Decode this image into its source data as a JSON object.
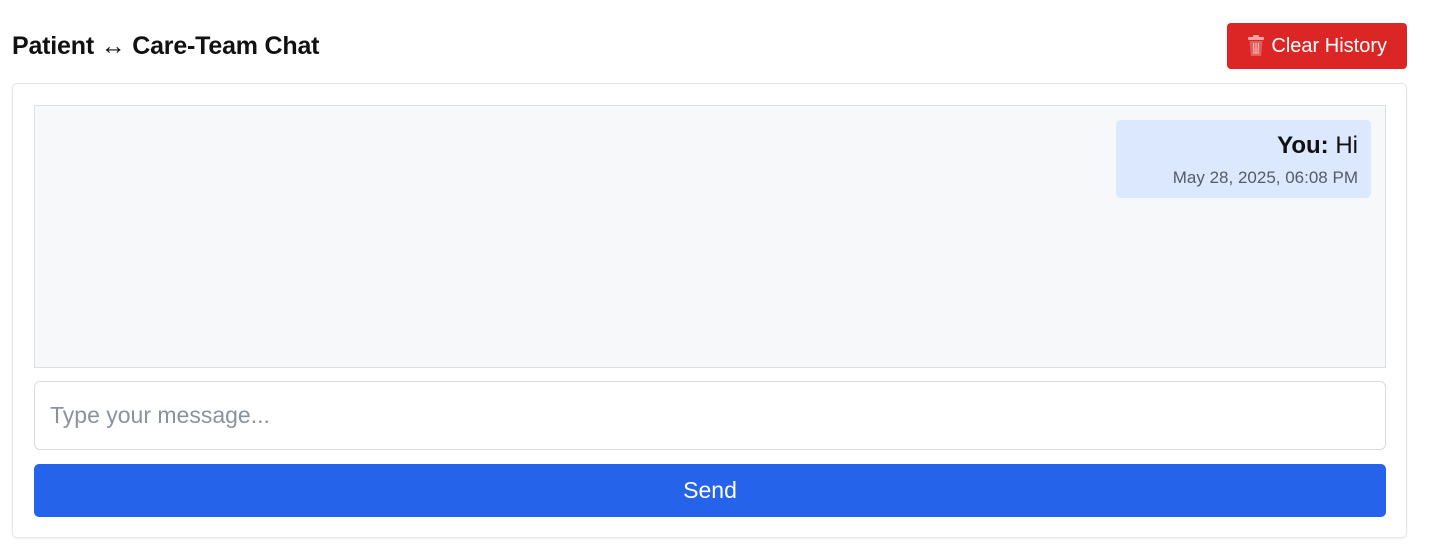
{
  "header": {
    "title": "Patient ↔ Care-Team Chat",
    "clear_button": {
      "icon": "trash-icon",
      "label": "Clear History"
    }
  },
  "colors": {
    "clear_button": "#dc2626",
    "send_button": "#2563eb",
    "bubble_bg": "#dbe8fd",
    "messages_bg": "#f7f8fa"
  },
  "messages": [
    {
      "sender": "You:",
      "text": "Hi",
      "timestamp": "May 28, 2025, 06:08 PM"
    }
  ],
  "composer": {
    "placeholder": "Type your message...",
    "value": "",
    "send_label": "Send"
  }
}
